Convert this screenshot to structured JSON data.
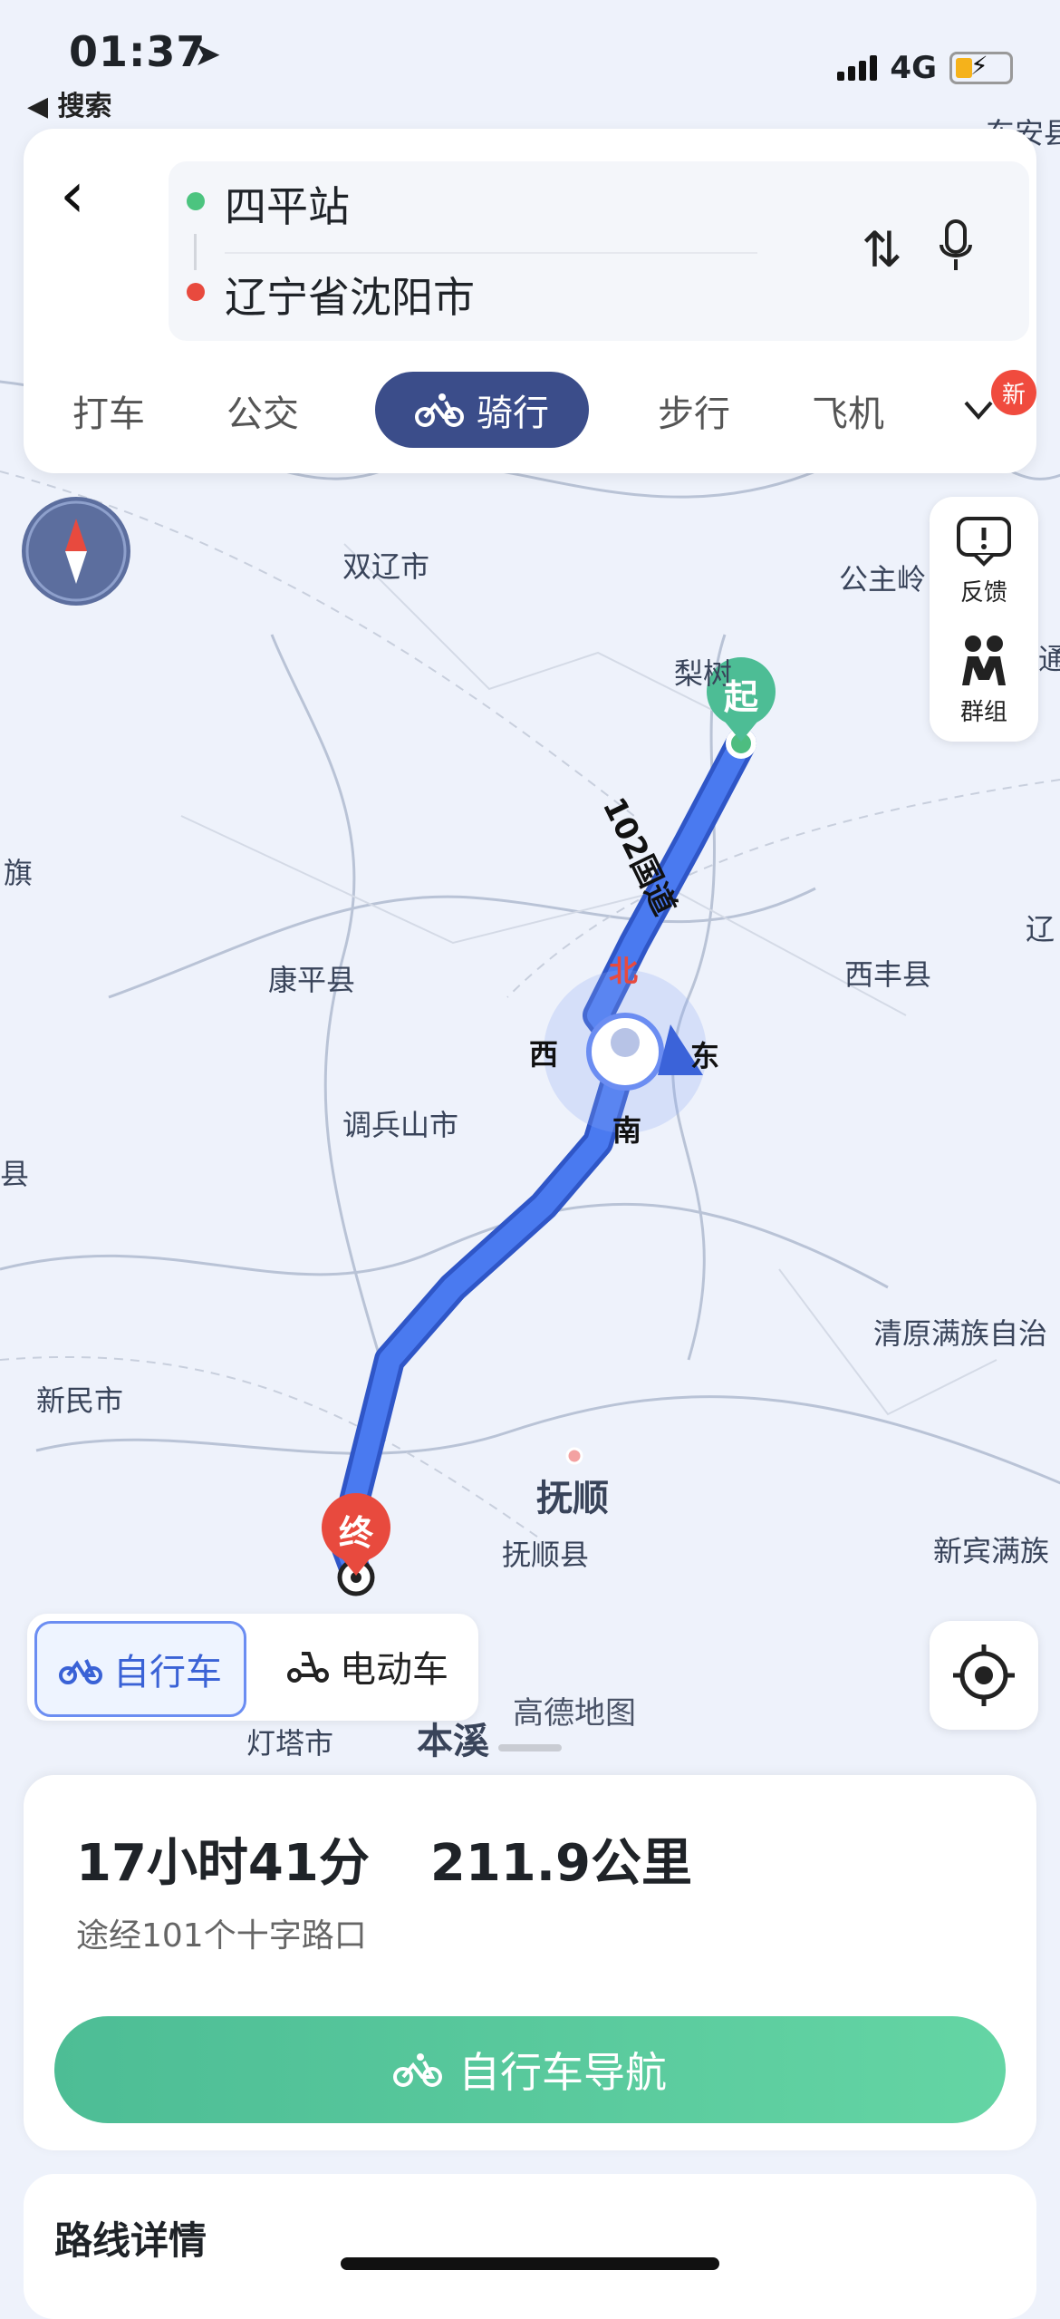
{
  "status_bar": {
    "time": "01:37",
    "back_label": "◀ 搜索",
    "network": "4G"
  },
  "route": {
    "origin": "四平站",
    "destination": "辽宁省沈阳市"
  },
  "tabs": [
    "打车",
    "公交",
    "骑行",
    "步行",
    "飞机"
  ],
  "active_tab": "骑行",
  "new_badge": "新",
  "side_panel": {
    "feedback": "反馈",
    "group": "群组"
  },
  "map": {
    "labels": [
      "双辽市",
      "公主岭",
      "梨树",
      "康平县",
      "西丰县",
      "调兵山市",
      "清原满族自治",
      "新民市",
      "抚顺",
      "抚顺县",
      "新宾满族",
      "灯塔市",
      "本溪",
      "旗",
      "县",
      "通",
      "辽",
      "东安县"
    ],
    "start_marker": "起",
    "end_marker": "终",
    "road_label": "102国道",
    "compass_directions": {
      "north": "北",
      "south": "南",
      "east": "东",
      "west": "西"
    },
    "watermark": "高德地图"
  },
  "modes": {
    "bike": "自行车",
    "ebike": "电动车"
  },
  "summary": {
    "duration": "17小时41分",
    "distance": "211.9公里",
    "via": "途经101个十字路口"
  },
  "nav_button": "自行车导航",
  "details_title": "路线详情"
}
